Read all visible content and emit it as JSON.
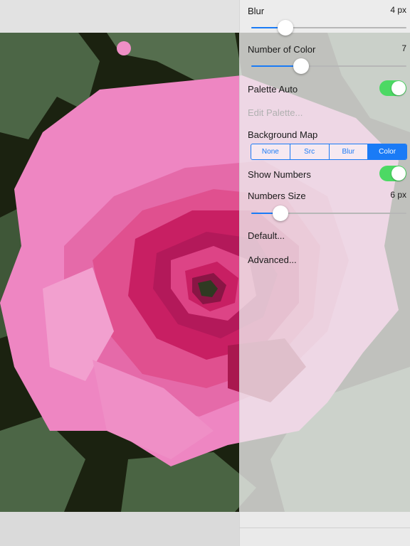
{
  "settings": {
    "blur": {
      "label": "Blur",
      "value": "4 px",
      "level": 0.22
    },
    "number_of_color": {
      "label": "Number of Color",
      "value": "7",
      "level": 0.32
    },
    "palette_auto": {
      "label": "Palette Auto",
      "on": true
    },
    "edit_palette": {
      "label": "Edit Palette..."
    },
    "background_map": {
      "label": "Background Map",
      "options": [
        "None",
        "Src",
        "Blur",
        "Color"
      ],
      "selected": "Color"
    },
    "show_numbers": {
      "label": "Show Numbers",
      "on": true
    },
    "numbers_size": {
      "label": "Numbers Size",
      "value": "6 px",
      "level": 0.19
    },
    "default": {
      "label": "Default..."
    },
    "advanced": {
      "label": "Advanced..."
    }
  },
  "colors": {
    "accent": "#1a7bf6",
    "toggle_on": "#4cd964",
    "rose_light": "#ee86c2",
    "rose_mid": "#e0508f",
    "rose_deep": "#c81f63",
    "leaf": "#4c6646",
    "background_dark": "#1b2210"
  }
}
